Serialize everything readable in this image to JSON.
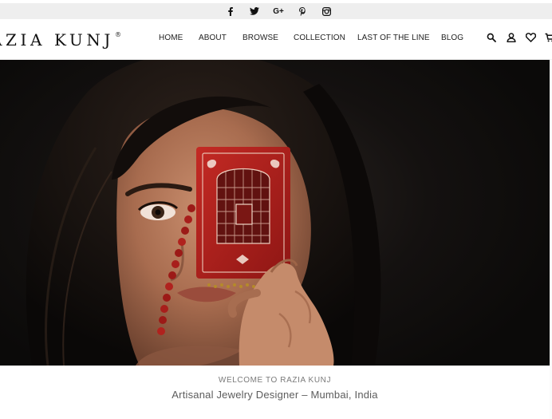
{
  "social": {
    "icons": [
      "facebook-icon",
      "twitter-icon",
      "google-plus-icon",
      "pinterest-icon",
      "instagram-icon"
    ],
    "google_plus_label": "G+"
  },
  "header": {
    "logo_text": "AZIA KUNJ",
    "logo_mark": "®",
    "nav": [
      {
        "label": "HOME"
      },
      {
        "label": "ABOUT"
      },
      {
        "label": "BROWSE"
      },
      {
        "label": "COLLECTION"
      },
      {
        "label": "LAST OF THE LINE"
      },
      {
        "label": "BLOG"
      }
    ],
    "tools": [
      "search-icon",
      "account-icon",
      "wishlist-heart-icon",
      "cart-icon"
    ]
  },
  "hero": {
    "subject": "model-holding-red-jali-clutch"
  },
  "welcome": {
    "eyebrow": "WELCOME TO RAZIA KUNJ",
    "tagline": "Artisanal Jewelry Designer – Mumbai, India"
  },
  "colors": {
    "topbar_bg": "#eeeeee",
    "hero_bg": "#141110",
    "accent_red": "#b3201d",
    "text_dark": "#222222",
    "text_muted": "#7a7a7a"
  }
}
